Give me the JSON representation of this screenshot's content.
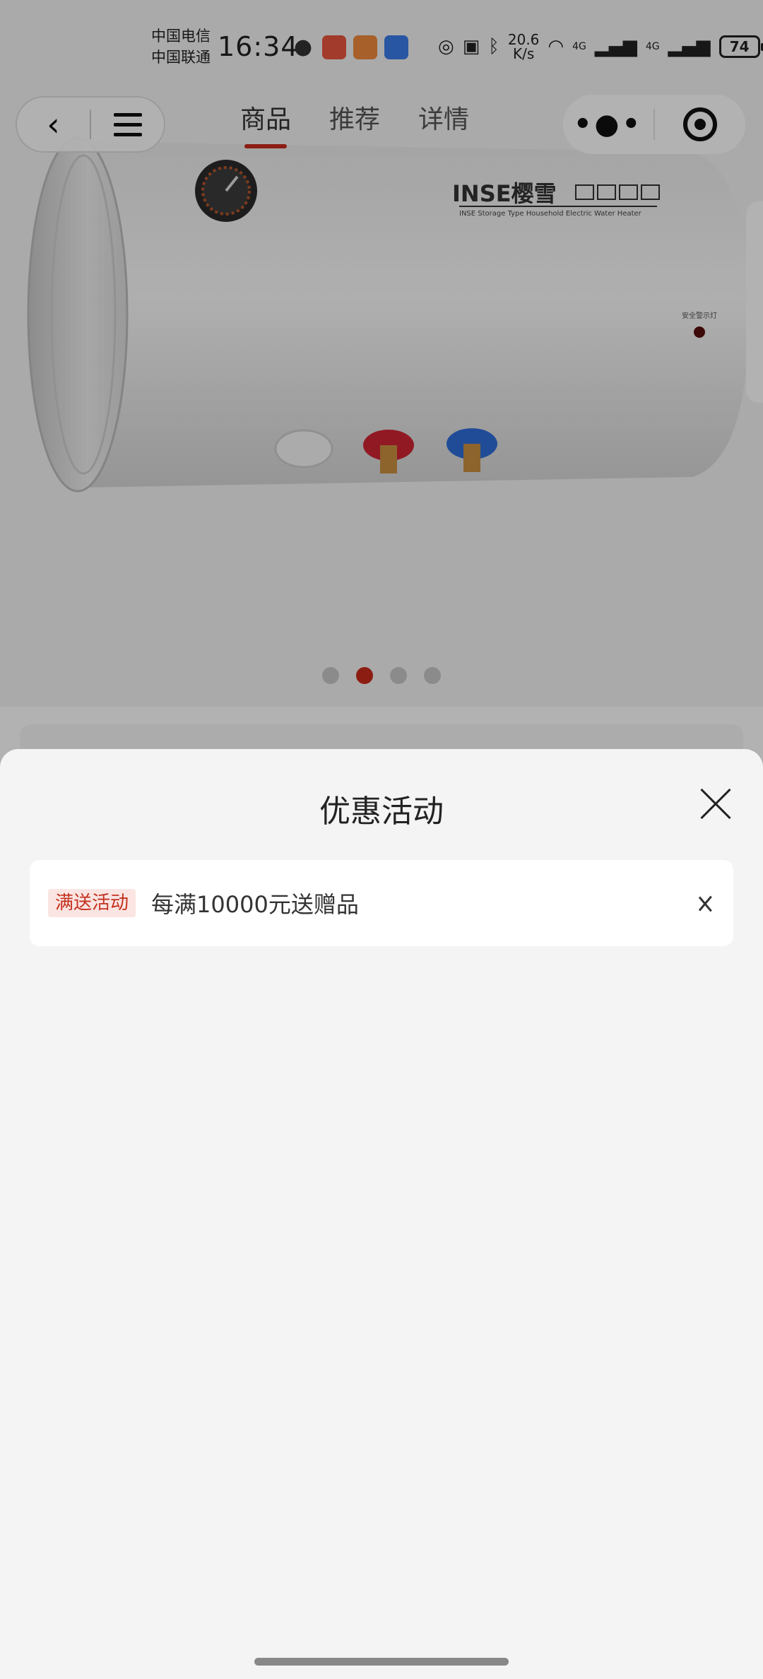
{
  "status_bar": {
    "carrier_1": "中国电信",
    "carrier_2": "中国联通",
    "time": "16:34",
    "net_speed_value": "20.6",
    "net_speed_unit": "K/s",
    "signal_1": "4G",
    "signal_2": "4G",
    "battery": "74"
  },
  "nav": {
    "back_icon": "chevron-left-icon",
    "menu_icon": "menu-icon",
    "tabs": [
      {
        "label": "商品"
      },
      {
        "label": "推荐"
      },
      {
        "label": "详情"
      }
    ],
    "more_label": "•●•",
    "accent_color": "#c92a1b"
  },
  "product": {
    "brand_text": "INSE樱雪",
    "brand_subtitle": "INSE Storage Type Household Electric Water Heater",
    "indicator_label": "安全警示灯",
    "carousel_count": 4,
    "carousel_active_index": 1
  },
  "sheet": {
    "title": "优惠活动",
    "promotions": [
      {
        "tag": "满送活动",
        "text": "每满10000元送赠品"
      }
    ]
  }
}
